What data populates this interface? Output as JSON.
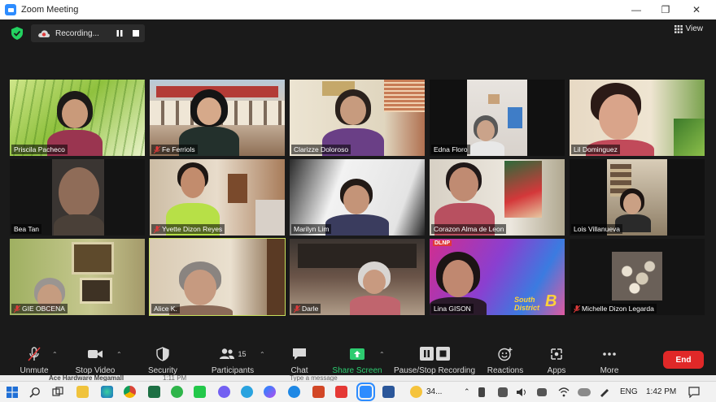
{
  "window": {
    "title": "Zoom Meeting"
  },
  "recording": {
    "label": "Recording..."
  },
  "view_label": "View",
  "participants": [
    {
      "name": "Priscila Pacheco",
      "muted": false
    },
    {
      "name": "Fe Ferriols",
      "muted": true
    },
    {
      "name": "Clarizze Doloroso",
      "muted": false
    },
    {
      "name": "Edna Floro",
      "muted": false
    },
    {
      "name": "Lil Dominguez",
      "muted": false
    },
    {
      "name": "Bea Tan",
      "muted": false
    },
    {
      "name": "Yvette Dizon Reyes",
      "muted": true
    },
    {
      "name": "Marilyn Lim",
      "muted": false
    },
    {
      "name": "Corazon Alma de Leon",
      "muted": false
    },
    {
      "name": "Lois Villanueva",
      "muted": false
    },
    {
      "name": "GIE OBCENA",
      "muted": true
    },
    {
      "name": "Alice K.",
      "muted": false
    },
    {
      "name": "Darle",
      "muted": true
    },
    {
      "name": "Lina GISON",
      "muted": false
    },
    {
      "name": "Michelle Dizon Legarda",
      "muted": true
    }
  ],
  "tile_badges": {
    "dlnp": "DLNP",
    "south_district": "South",
    "district_text": "District",
    "district_letter": "B"
  },
  "toolbar": {
    "unmute": "Unmute",
    "stop_video": "Stop Video",
    "security": "Security",
    "participants": "Participants",
    "participants_count": "15",
    "chat": "Chat",
    "share_screen": "Share Screen",
    "pause_stop_recording": "Pause/Stop Recording",
    "reactions": "Reactions",
    "apps": "Apps",
    "more": "More",
    "end": "End"
  },
  "chat_strip": {
    "sender": "Ace Hardware Megamall",
    "time": "1:11 PM",
    "placeholder": "Type a message"
  },
  "taskbar": {
    "badge_count": "34...",
    "language": "ENG",
    "time": "1:42 PM"
  },
  "colors": {
    "accent": "#2d8cff",
    "end_red": "#e02828",
    "share_green": "#2dcc70",
    "active_speaker": "#c8e05c",
    "muted_red": "#e03a3a"
  }
}
